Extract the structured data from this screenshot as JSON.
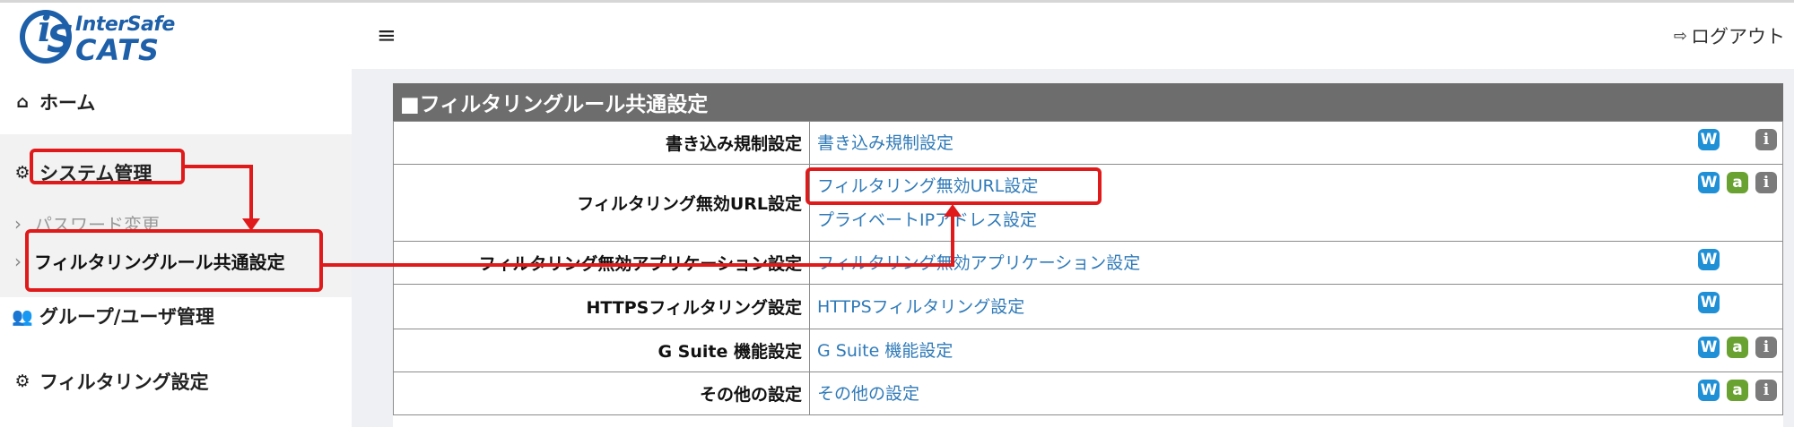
{
  "brand": {
    "line1": "InterSafe",
    "line2": "CATS",
    "mark_i": "i",
    "mark_s": "S",
    "color": "#1d5fa8"
  },
  "header": {
    "menu_glyph": "≡",
    "logout_label": "ログアウト"
  },
  "sidebar": {
    "home": "ホーム",
    "system": "システム管理",
    "system_sub": [
      "パスワード変更",
      "フィルタリングルール共通設定"
    ],
    "group_user": "グループ/ユーザ管理",
    "filtering": "フィルタリング設定"
  },
  "panel": {
    "title": "■フィルタリングルール共通設定",
    "rows": [
      {
        "label": "書き込み規制設定",
        "links": [
          "書き込み規制設定"
        ],
        "badges": [
          "W",
          "",
          "i"
        ]
      },
      {
        "label": "フィルタリング無効URL設定",
        "links": [
          "フィルタリング無効URL設定",
          "プライベートIPアドレス設定"
        ],
        "badges": [
          "W",
          "a",
          "i"
        ]
      },
      {
        "label": "フィルタリング無効アプリケーション設定",
        "links": [
          "フィルタリング無効アプリケーション設定"
        ],
        "badges": [
          "W",
          "",
          ""
        ]
      },
      {
        "label": "HTTPSフィルタリング設定",
        "links": [
          "HTTPSフィルタリング設定"
        ],
        "badges": [
          "W",
          "",
          ""
        ]
      },
      {
        "label": "G Suite 機能設定",
        "links": [
          "G Suite 機能設定"
        ],
        "badges": [
          "W",
          "a",
          "i"
        ]
      },
      {
        "label": "その他の設定",
        "links": [
          "その他の設定"
        ],
        "badges": [
          "W",
          "a",
          "i"
        ]
      }
    ]
  },
  "colors": {
    "panel_header": "#6d6d6d",
    "link": "#2f7ab8",
    "annotation": "#e01a1a",
    "content_bg": "#eef0f4"
  }
}
